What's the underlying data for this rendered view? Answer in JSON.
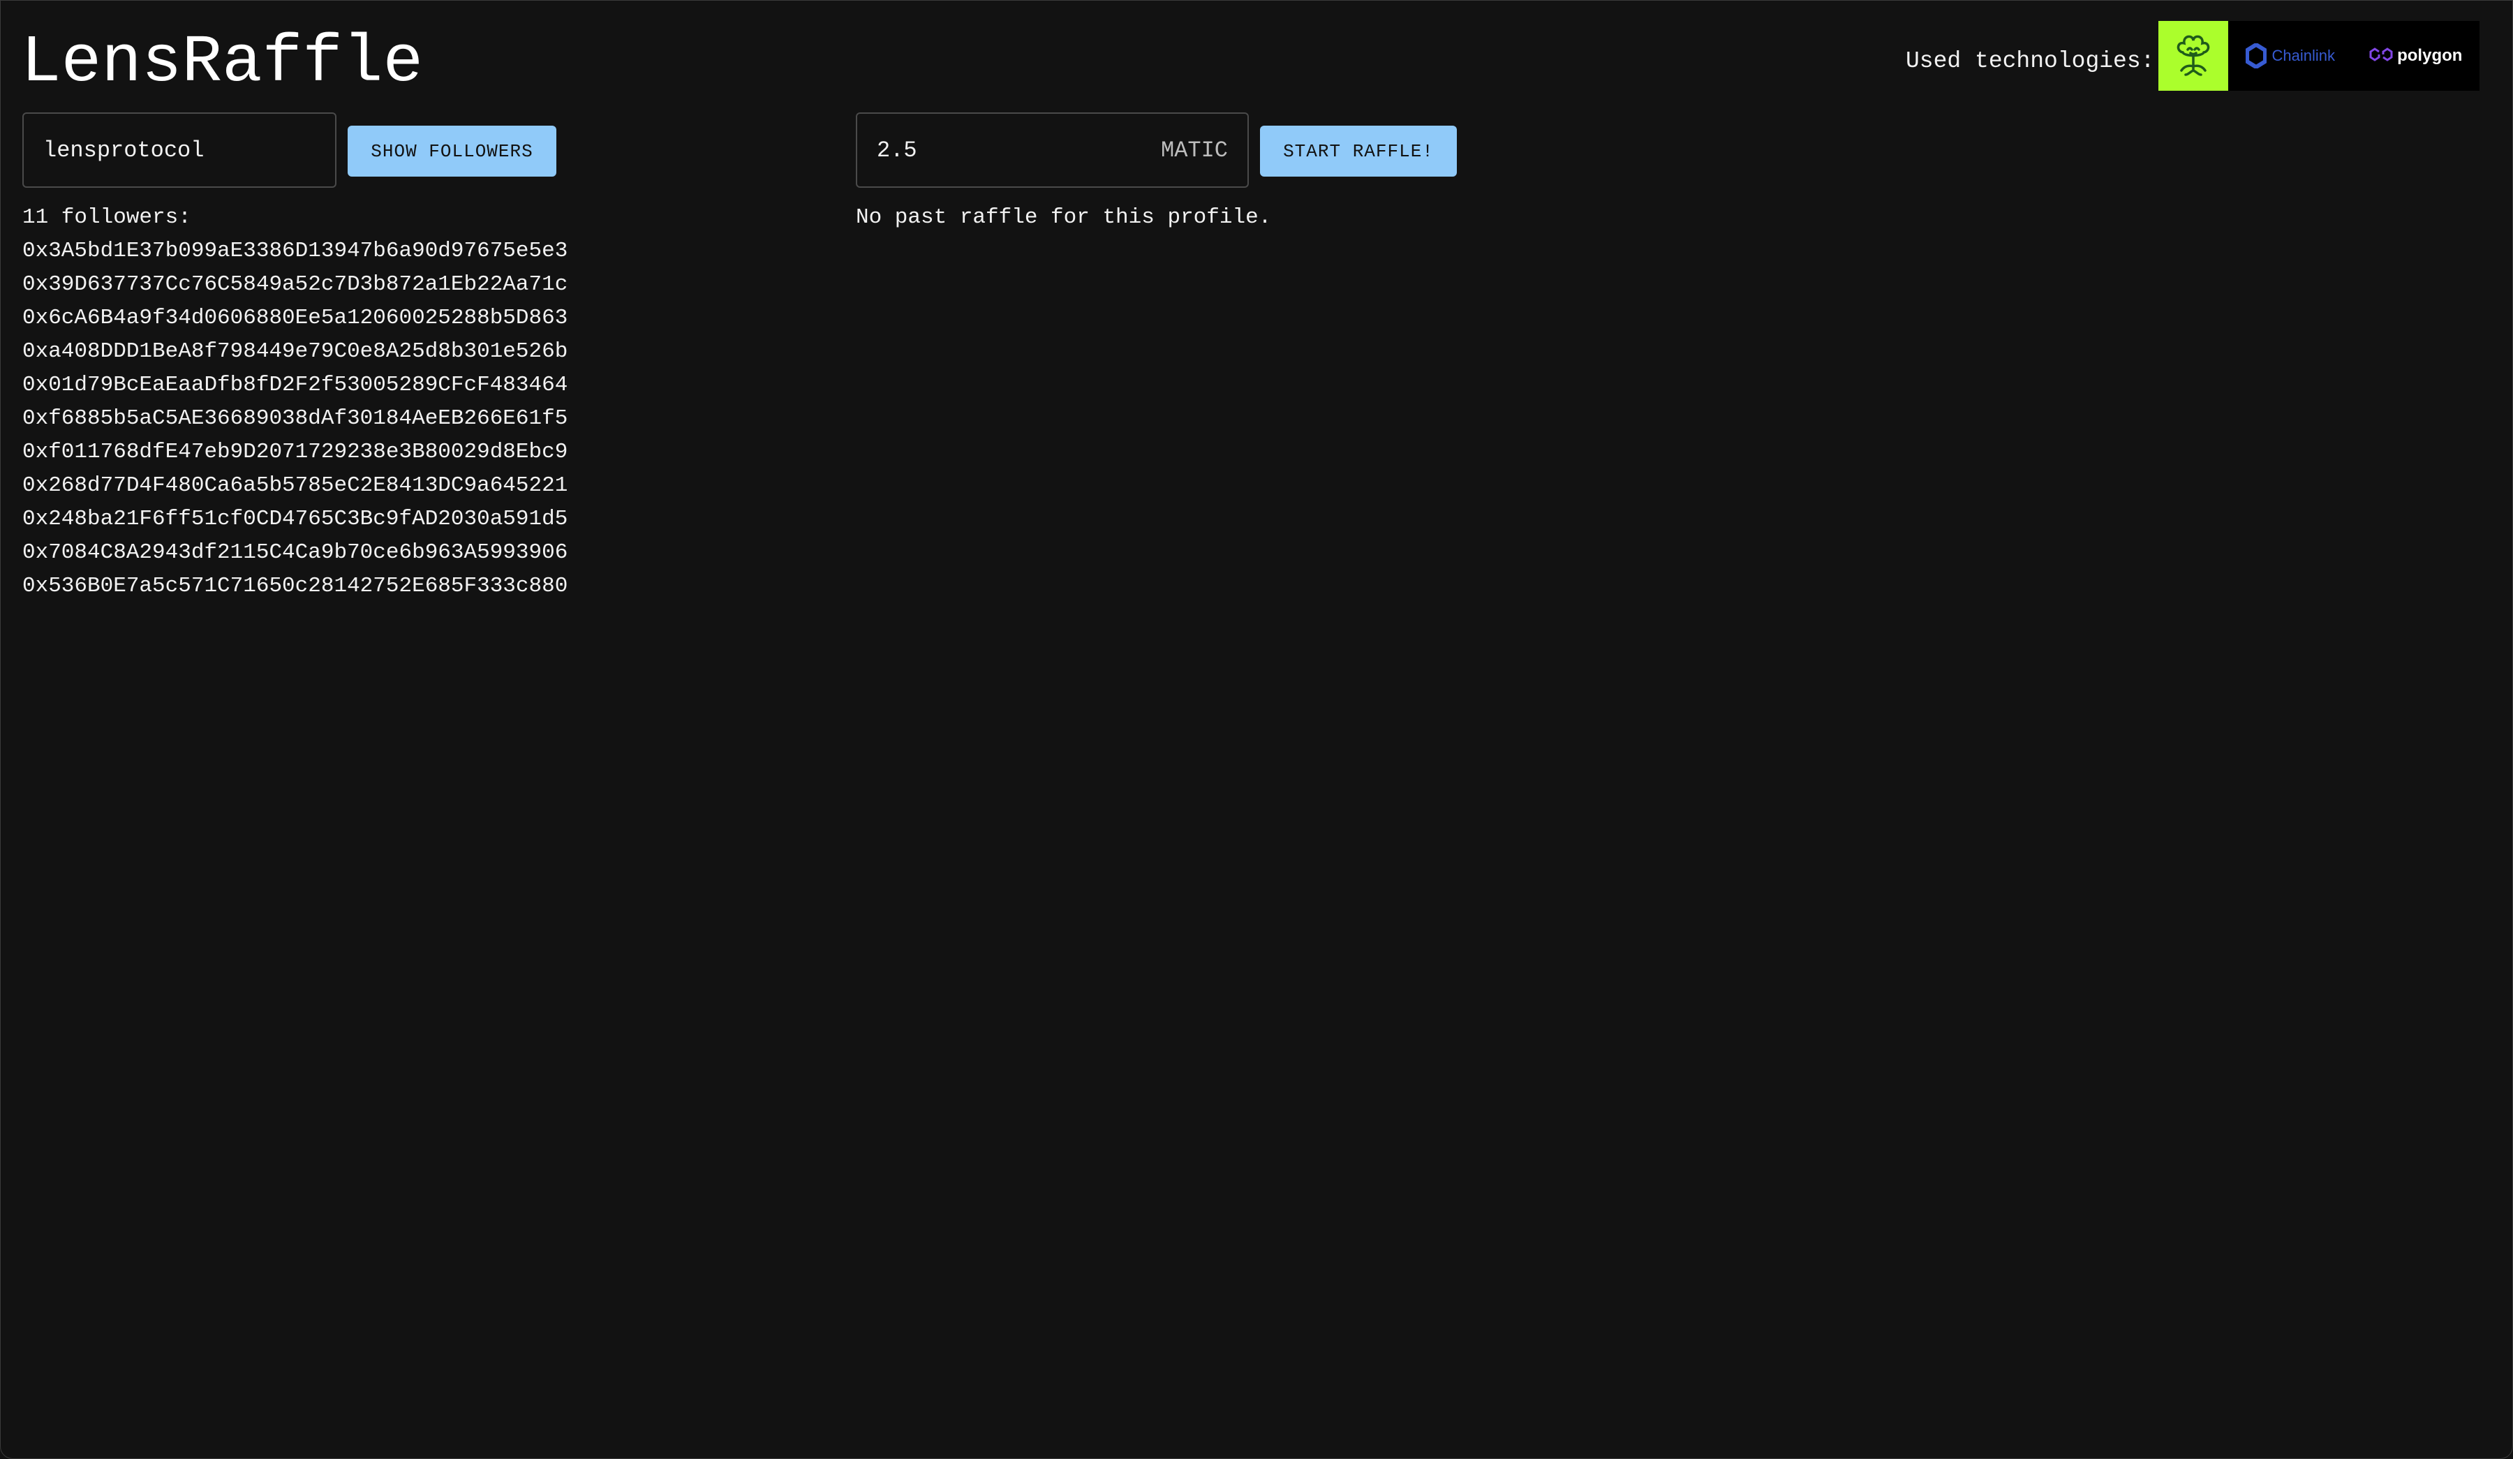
{
  "app": {
    "title": "LensRaffle"
  },
  "profile_search": {
    "value": "lensprotocol",
    "button_label": "SHOW FOLLOWERS"
  },
  "raffle": {
    "amount_value": "2.5",
    "currency": "MATIC",
    "button_label": "START RAFFLE!",
    "status": "No past raffle for this profile."
  },
  "followers": {
    "count_label": "11 followers:",
    "addresses": [
      "0x3A5bd1E37b099aE3386D13947b6a90d97675e5e3",
      "0x39D637737Cc76C5849a52c7D3b872a1Eb22Aa71c",
      "0x6cA6B4a9f34d0606880Ee5a12060025288b5D863",
      "0xa408DDD1BeA8f798449e79C0e8A25d8b301e526b",
      "0x01d79BcEaEaaDfb8fD2F2f53005289CFcF483464",
      "0xf6885b5aC5AE36689038dAf30184AeEB266E61f5",
      "0xf011768dfE47eb9D2071729238e3B80029d8Ebc9",
      "0x268d77D4F480Ca6a5b5785eC2E8413DC9a645221",
      "0x248ba21F6ff51cf0CD4765C3Bc9fAD2030a591d5",
      "0x7084C8A2943df2115C4Ca9b70ce6b963A5993906",
      "0x536B0E7a5c571C71650c28142752E685F333c880"
    ]
  },
  "technologies": {
    "label": "Used technologies:",
    "logos": [
      {
        "name": "Lens",
        "icon": "lens-icon",
        "color": "#abfe2c"
      },
      {
        "name": "Chainlink",
        "icon": "chainlink-icon",
        "color": "#375bd2"
      },
      {
        "name": "polygon",
        "icon": "polygon-icon",
        "color": "#8247e5"
      }
    ]
  },
  "colors": {
    "background": "#121212",
    "button": "#90caf9",
    "text": "#f2f2f2"
  }
}
